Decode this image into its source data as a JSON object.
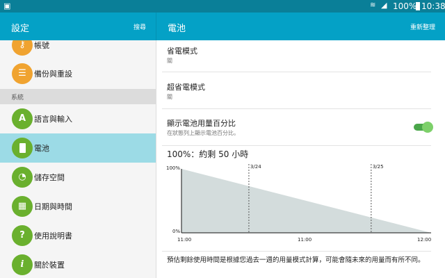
{
  "status_bar": {
    "notification_icon": "clipboard-icon",
    "wifi_icon": "wifi-icon",
    "signal_icon": "signal-icon",
    "battery_percent": "100%",
    "battery_icon": "battery-icon",
    "time": "10:38"
  },
  "left_header": {
    "title": "設定",
    "action": "搜尋"
  },
  "right_header": {
    "title": "電池",
    "action": "重新整理"
  },
  "sidebar": {
    "items": [
      {
        "label": "帳號",
        "icon": "key-icon",
        "color": "#f0a330"
      },
      {
        "label": "備份與重設",
        "icon": "backup-icon",
        "color": "#f0a330"
      }
    ],
    "section": "系統",
    "system_items": [
      {
        "label": "語言與輸入",
        "icon": "language-icon",
        "color": "#6ab02e"
      },
      {
        "label": "電池",
        "icon": "battery-icon",
        "color": "#6ab02e",
        "selected": true
      },
      {
        "label": "儲存空間",
        "icon": "storage-icon",
        "color": "#6ab02e"
      },
      {
        "label": "日期與時間",
        "icon": "calendar-clock-icon",
        "color": "#6ab02e"
      },
      {
        "label": "使用說明書",
        "icon": "help-book-icon",
        "color": "#6ab02e"
      },
      {
        "label": "關於裝置",
        "icon": "info-icon",
        "color": "#6ab02e"
      }
    ]
  },
  "main": {
    "power_saving": {
      "title": "省電模式",
      "value": "關"
    },
    "ultra_power_saving": {
      "title": "超省電模式",
      "value": "關"
    },
    "show_percentage": {
      "title": "顯示電池用量百分比",
      "subtitle": "在狀態列上顯示電池百分比。",
      "enabled": true
    },
    "estimate": "100%：約剩 50 小時",
    "graph": {
      "type": "area",
      "y_labels": [
        "100%",
        "0%"
      ],
      "x_labels": [
        "11:00",
        "11:00",
        "12:00"
      ],
      "date_markers": [
        {
          "label": "3/24",
          "position": 0.27
        },
        {
          "label": "3/25",
          "position": 0.76
        }
      ],
      "points": [
        {
          "t": 0,
          "level": 100
        },
        {
          "t": 1,
          "level": 0
        }
      ],
      "fill": "#d3dcdc"
    },
    "footnote": "預估剩餘使用時間是根據您過去一週的用量模式計算，可能會隨未來的用量而有所不同。"
  }
}
